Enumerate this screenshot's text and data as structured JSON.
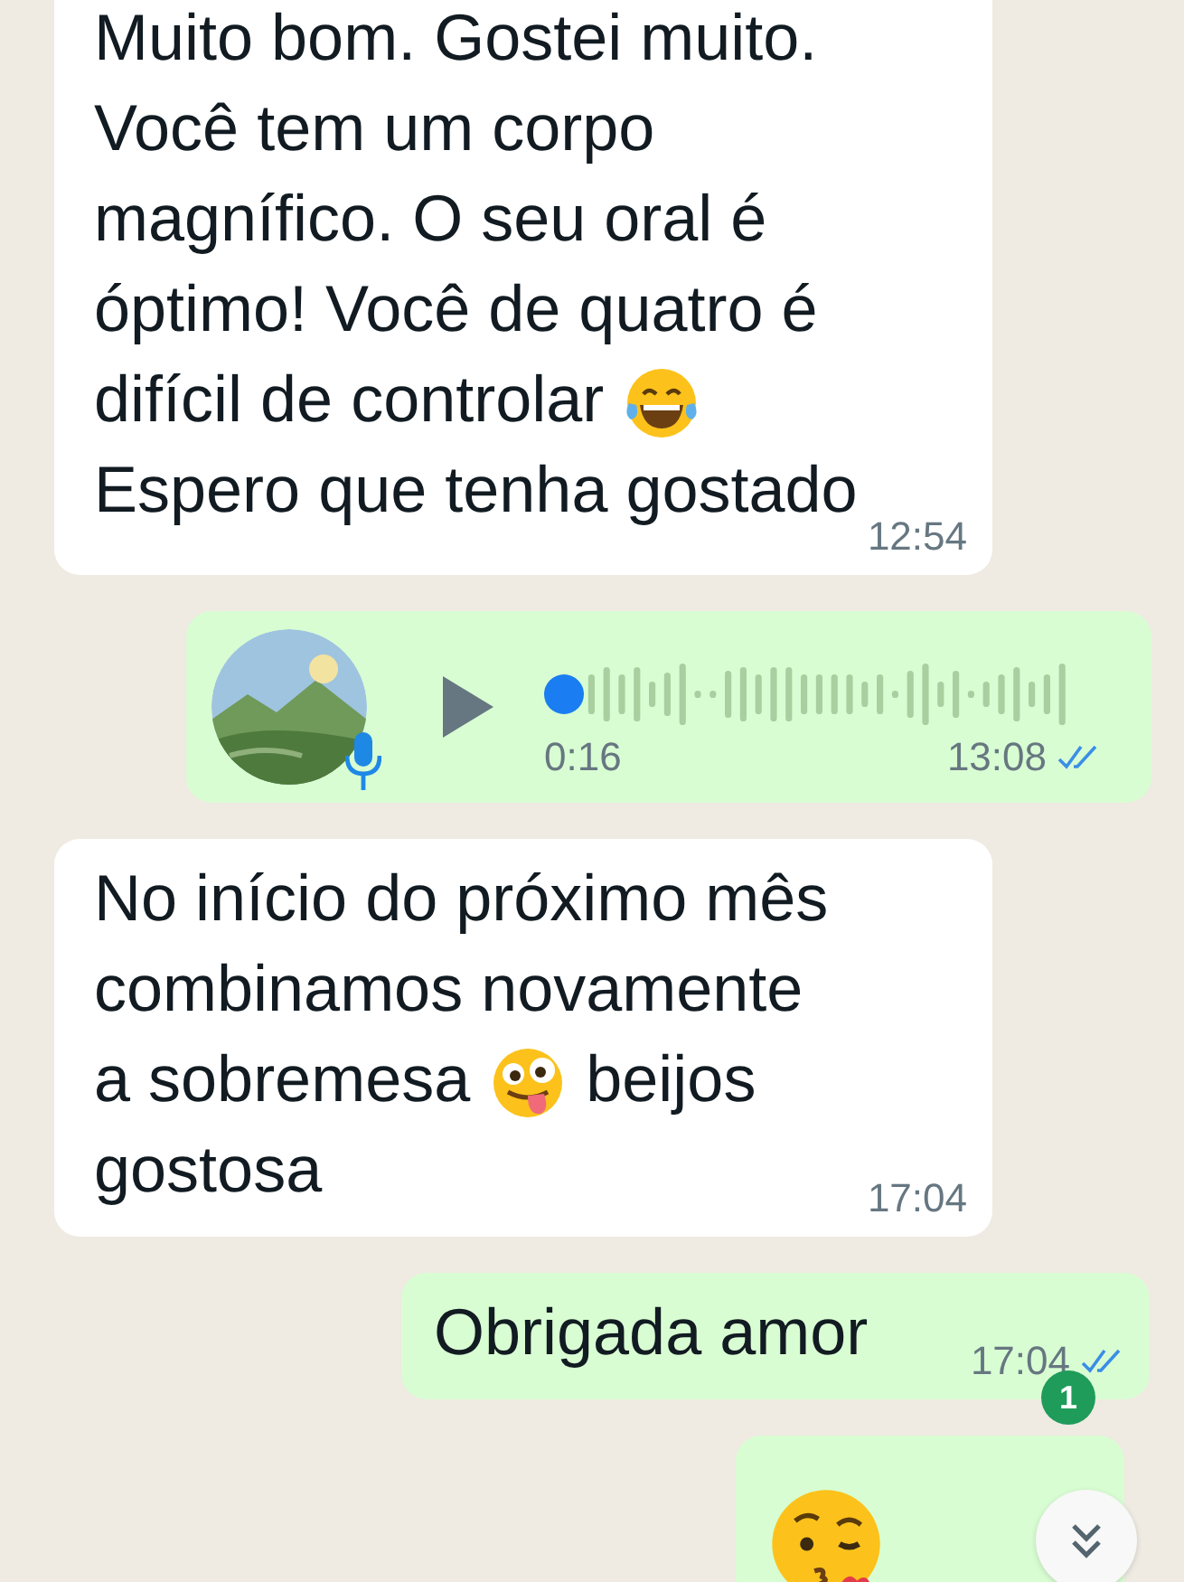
{
  "messages": [
    {
      "kind": "text",
      "outgoing": false,
      "time": "12:54",
      "lines": [
        [
          {
            "kind": "text",
            "text": "Muito bom. Gostei muito."
          }
        ],
        [
          {
            "kind": "text",
            "text": "Você tem um corpo"
          }
        ],
        [
          {
            "kind": "text",
            "text": "magnífico. O seu oral é"
          }
        ],
        [
          {
            "kind": "text",
            "text": "óptimo! Você de quatro é"
          }
        ],
        [
          {
            "kind": "text",
            "text": "difícil de controlar"
          },
          {
            "kind": "laugh"
          }
        ],
        [
          {
            "kind": "text",
            "text": "Espero que tenha gostado"
          }
        ]
      ]
    },
    {
      "kind": "voice",
      "outgoing": true,
      "duration": "0:16",
      "time": "13:08",
      "read": true
    },
    {
      "kind": "text",
      "outgoing": false,
      "time": "17:04",
      "lines": [
        [
          {
            "kind": "text",
            "text": "No início do próximo mês"
          }
        ],
        [
          {
            "kind": "text",
            "text": "combinamos novamente"
          }
        ],
        [
          {
            "kind": "text",
            "text": "a sobremesa"
          },
          {
            "kind": "tongue"
          },
          {
            "kind": "text",
            "text": "beijos"
          }
        ],
        [
          {
            "kind": "text",
            "text": "gostosa"
          }
        ]
      ]
    },
    {
      "kind": "text",
      "outgoing": true,
      "time": "17:04",
      "read": true,
      "lines": [
        [
          {
            "kind": "text",
            "text": "Obrigada amor"
          }
        ]
      ]
    },
    {
      "kind": "text",
      "outgoing": true,
      "lines": [
        [
          {
            "kind": "kiss"
          }
        ]
      ]
    }
  ],
  "unread_badge": "1"
}
